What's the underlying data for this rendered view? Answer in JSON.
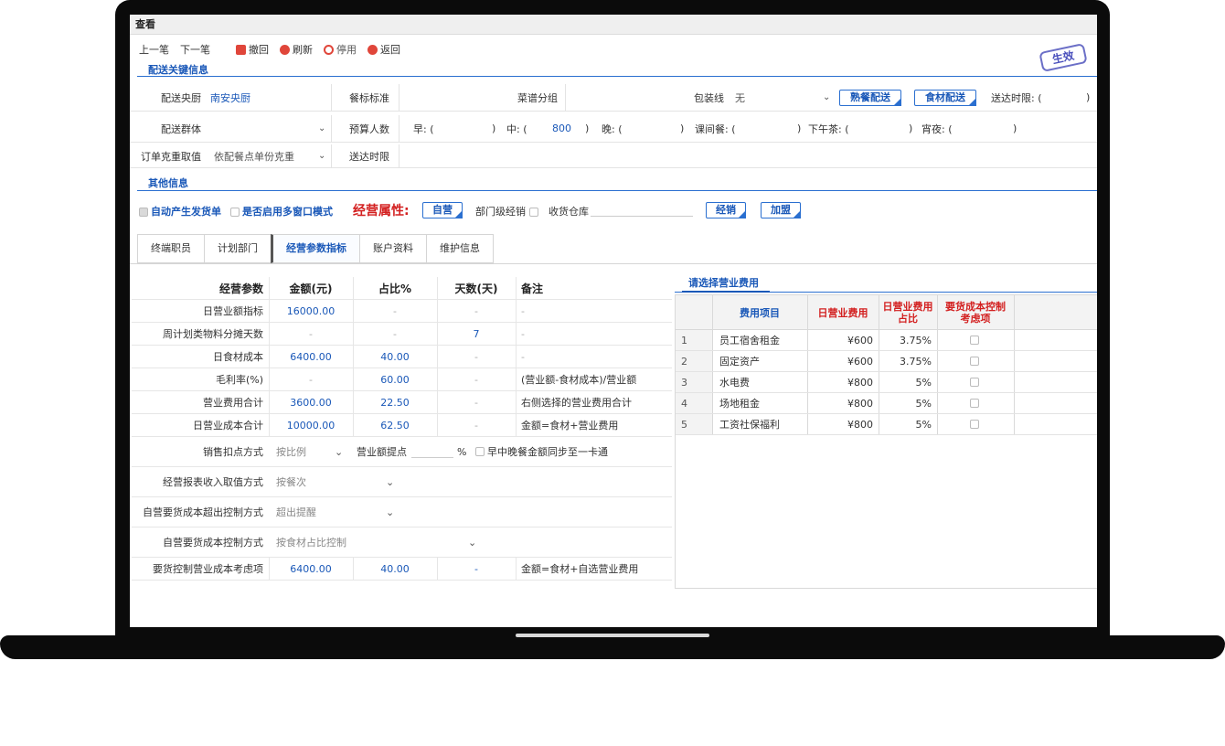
{
  "window": {
    "title": "查看"
  },
  "toolbar": {
    "prev": "上一笔",
    "next": "下一笔",
    "withdraw": "撤回",
    "refresh": "刷新",
    "disable": "停用",
    "back": "返回"
  },
  "stamp": "生效",
  "sections": {
    "key_info": "配送关键信息",
    "other_info": "其他信息"
  },
  "row1": {
    "kitchen_label": "配送央厨",
    "kitchen_value": "南安央厨",
    "meal_std_label": "餐标标准",
    "menu_group_label": "菜谱分组",
    "pack_line_label": "包装线",
    "pack_line_value": "无",
    "cooked_btn": "熟餐配送",
    "food_btn": "食材配送",
    "deadline_label": "送达时限: (",
    "deadline_close": ")"
  },
  "row2": {
    "group_label": "配送群体",
    "budget_label": "预算人数",
    "breakfast": "早: (",
    "breakfast_close": ")",
    "lunch": "中: (",
    "lunch_value": "800",
    "lunch_close": ")",
    "dinner": "晚: (",
    "dinner_close": ")",
    "class_meal": "课间餐: (",
    "class_meal_close": ")",
    "tea": "下午茶: (",
    "tea_close": ")",
    "night": "宵夜: (",
    "night_close": ")"
  },
  "row3": {
    "weight_label": "订单克重取值",
    "weight_value": "依配餐点单份克重",
    "deadline_label": "送达时限"
  },
  "options": {
    "auto_dispatch": "自动产生发货单",
    "multi_window": "是否启用多窗口模式",
    "biz_attr": "经营属性:",
    "self_btn": "自营",
    "dept_dist": "部门级经销",
    "warehouse": "收货仓库",
    "dist_btn": "经销",
    "franchise_btn": "加盟"
  },
  "tabs": [
    "终端职员",
    "计划部门",
    "经营参数指标",
    "账户资料",
    "维护信息"
  ],
  "params": {
    "headers": [
      "经营参数",
      "金额(元)",
      "占比%",
      "天数(天)",
      "备注"
    ],
    "rows": [
      {
        "name": "日营业额指标",
        "amount": "16000.00",
        "ratio": "-",
        "days": "-",
        "note": "-"
      },
      {
        "name": "周计划类物料分摊天数",
        "amount": "-",
        "ratio": "-",
        "days": "7",
        "note": "-"
      },
      {
        "name": "日食材成本",
        "amount": "6400.00",
        "ratio": "40.00",
        "days": "-",
        "note": "-"
      },
      {
        "name": "毛利率(%)",
        "amount": "-",
        "ratio": "60.00",
        "days": "-",
        "note": "(营业额-食材成本)/营业额"
      },
      {
        "name": "营业费用合计",
        "amount": "3600.00",
        "ratio": "22.50",
        "days": "-",
        "note": "右侧选择的营业费用合计"
      },
      {
        "name": "日营业成本合计",
        "amount": "10000.00",
        "ratio": "62.50",
        "days": "-",
        "note": "金额=食材+营业费用"
      }
    ],
    "discount_label": "销售扣点方式",
    "discount_value": "按比例",
    "revenue_point": "营业额提点",
    "percent": "%",
    "sync_label": "早中晚餐金额同步至一卡通",
    "income_label": "经营报表收入取值方式",
    "income_value": "按餐次",
    "over_label": "自营要货成本超出控制方式",
    "over_value": "超出提醒",
    "ctrl_label": "自营要货成本控制方式",
    "ctrl_value": "按食材占比控制",
    "cost_label": "要货控制营业成本考虑项",
    "cost_amount": "6400.00",
    "cost_ratio": "40.00",
    "cost_days": "-",
    "cost_note": "金额=食材+自选营业费用"
  },
  "expense": {
    "title": "请选择营业费用",
    "headers": [
      "费用项目",
      "日营业费用",
      "日营业费用占比",
      "要货成本控制考虑项"
    ],
    "rows": [
      {
        "no": "1",
        "item": "员工宿舍租金",
        "fee": "¥600",
        "ratio": "3.75%"
      },
      {
        "no": "2",
        "item": "固定资产",
        "fee": "¥600",
        "ratio": "3.75%"
      },
      {
        "no": "3",
        "item": "水电费",
        "fee": "¥800",
        "ratio": "5%"
      },
      {
        "no": "4",
        "item": "场地租金",
        "fee": "¥800",
        "ratio": "5%"
      },
      {
        "no": "5",
        "item": "工资社保福利",
        "fee": "¥800",
        "ratio": "5%"
      }
    ]
  },
  "icons": {
    "withdraw": "withdraw-icon",
    "refresh": "refresh-icon",
    "disable": "disable-icon",
    "back": "back-icon",
    "dropdown": "chevron-down-icon"
  },
  "colors": {
    "accent": "#1a58b8",
    "danger": "#d32020",
    "frame": "#0b0b0b"
  }
}
